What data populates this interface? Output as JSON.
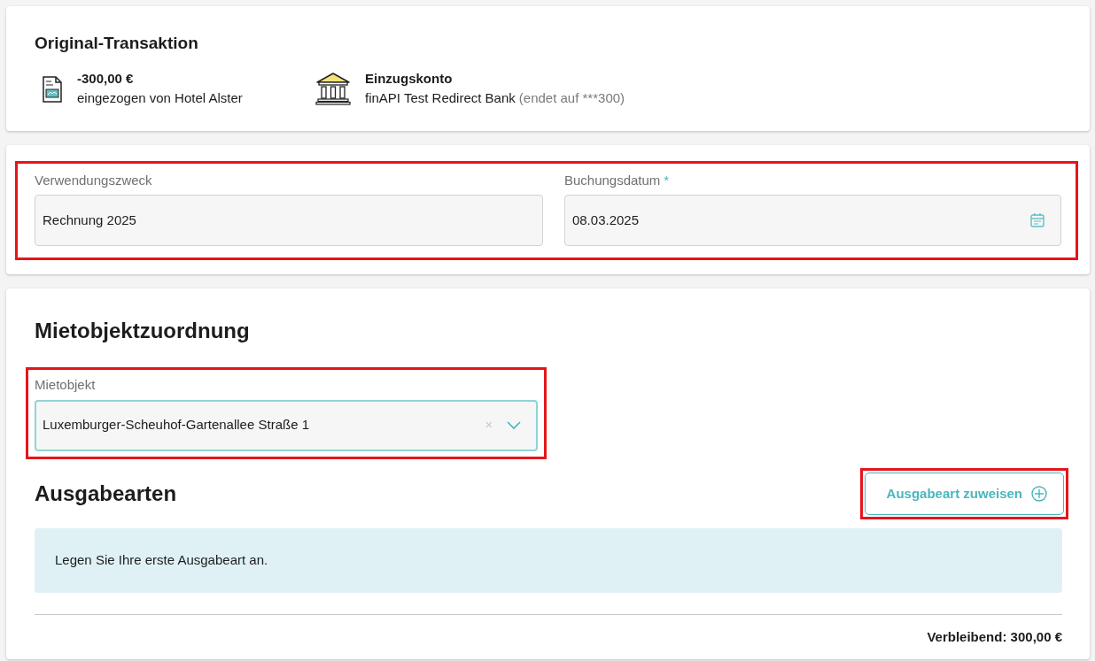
{
  "original_transaction": {
    "title": "Original-Transaktion",
    "amount": {
      "value": "-300,00 €",
      "description": "eingezogen von Hotel Alster"
    },
    "account": {
      "title": "Einzugskonto",
      "bank": "finAPI Test Redirect Bank",
      "suffix": "(endet auf ***300)"
    }
  },
  "booking": {
    "highlighted": true,
    "fields": [
      {
        "label": "Verwendungszweck",
        "value": "Rechnung 2025",
        "kind": "text"
      },
      {
        "label": "Buchungsdatum",
        "required_mark": "*",
        "value": "08.03.2025",
        "kind": "date"
      }
    ]
  },
  "assignment": {
    "title": "Mietobjektzuordnung",
    "property": {
      "label": "Mietobjekt",
      "value": "Luxemburger-Scheuhof-Gartenallee Straße 1",
      "highlighted": true,
      "clear": "×"
    },
    "expense_types": {
      "title": "Ausgabearten",
      "button": {
        "label": "Ausgabeart zuweisen",
        "highlighted": true
      },
      "empty_message": "Legen Sie Ihre erste Ausgabeart an."
    },
    "remaining": "Verbleibend: 300,00 €"
  }
}
